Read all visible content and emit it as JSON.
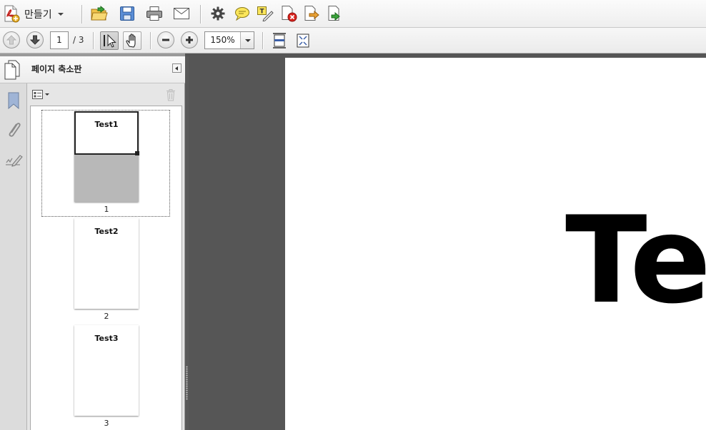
{
  "toolbar": {
    "create_label": "만들기",
    "icons": [
      "pdf-create-icon",
      "open-folder-icon",
      "save-icon",
      "print-icon",
      "email-icon",
      "settings-icon",
      "comment-icon",
      "highlight-icon",
      "delete-page-icon",
      "export-icon",
      "import-icon"
    ]
  },
  "navigation": {
    "current_page": "1",
    "page_count": "/ 3",
    "zoom": "150%"
  },
  "panel": {
    "title": "페이지 축소판",
    "thumbnails": [
      {
        "title": "Test1",
        "number": "1"
      },
      {
        "title": "Test2",
        "number": "2"
      },
      {
        "title": "Test3",
        "number": "3"
      }
    ]
  },
  "document": {
    "visible_text": "Te"
  }
}
